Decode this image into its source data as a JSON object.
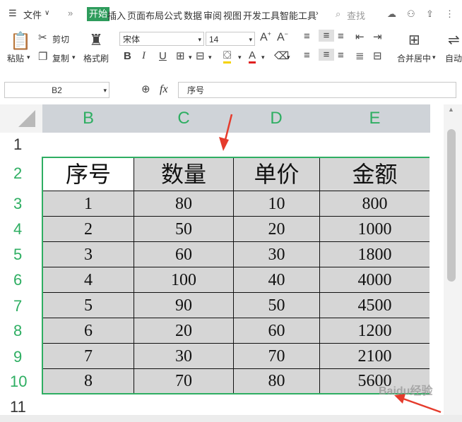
{
  "menubar": {
    "menu_label": "文件",
    "tabs": [
      "开始",
      "插入",
      "页面布局",
      "公式",
      "数据",
      "审阅",
      "视图",
      "开发工具",
      "智能工具"
    ],
    "search_label": "查找"
  },
  "ribbon": {
    "paste_label": "粘贴",
    "cut_label": "剪切",
    "copy_label": "复制",
    "format_painter_label": "格式刷",
    "font_name": "宋体",
    "font_size": "14",
    "merge_label": "合并居中",
    "autowrap_label": "自动"
  },
  "formula_bar": {
    "cell_ref": "B2",
    "fx_label": "fx",
    "content": "序号"
  },
  "grid": {
    "columns": [
      "B",
      "C",
      "D",
      "E"
    ],
    "rows": [
      "1",
      "2",
      "3",
      "4",
      "5",
      "6",
      "7",
      "8",
      "9",
      "10",
      "11"
    ],
    "header": [
      "序号",
      "数量",
      "单价",
      "金额"
    ],
    "data": [
      [
        "1",
        "80",
        "10",
        "800"
      ],
      [
        "2",
        "50",
        "20",
        "1000"
      ],
      [
        "3",
        "60",
        "30",
        "1800"
      ],
      [
        "4",
        "100",
        "40",
        "4000"
      ],
      [
        "5",
        "90",
        "50",
        "4500"
      ],
      [
        "6",
        "20",
        "60",
        "1200"
      ],
      [
        "7",
        "30",
        "70",
        "2100"
      ],
      [
        "8",
        "70",
        "80",
        "5600"
      ]
    ]
  },
  "watermark": "Baidu经验",
  "colors": {
    "accent": "#2e9c5c",
    "selection_border": "#2eae62",
    "cell_fill": "#d6d6d6",
    "arrow": "#e53b2c"
  }
}
